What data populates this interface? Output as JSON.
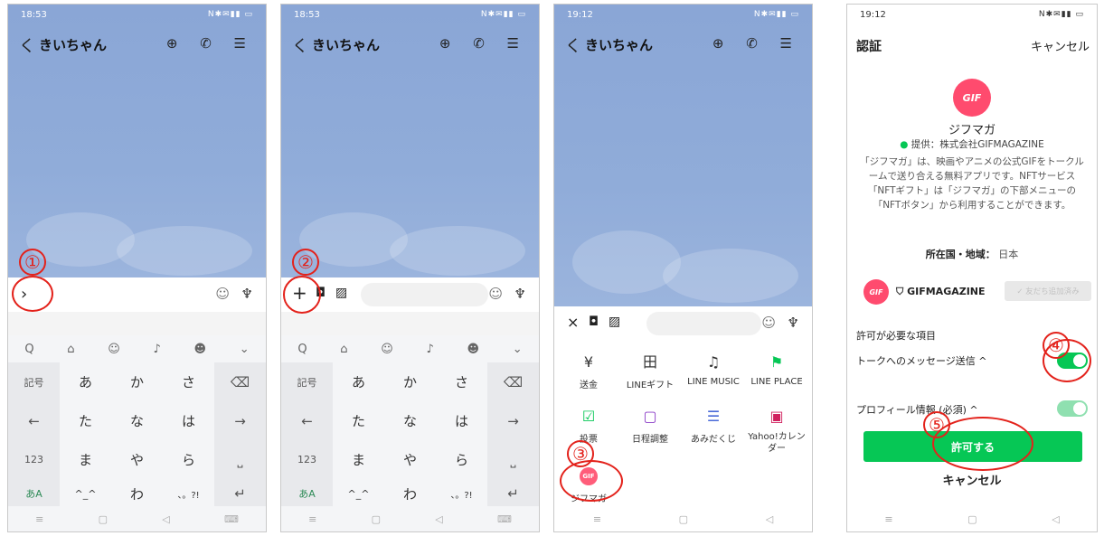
{
  "chat": {
    "status_time_1": "18:53",
    "status_time_3": "19:12",
    "status_icons": "N✱✉▮▮ ▭",
    "contact_name": "きいちゃん",
    "back": "く",
    "header_icons": "⊕ ✆ ☰"
  },
  "keyboard": {
    "top_icons": [
      "Q",
      "⌂",
      "☺",
      "♪",
      "☻",
      "⌄"
    ],
    "rows": [
      [
        "記号",
        "あ",
        "か",
        "さ",
        "⌫"
      ],
      [
        "←",
        "た",
        "な",
        "は",
        "→"
      ],
      [
        "123",
        "ま",
        "や",
        "ら",
        "⎵"
      ],
      [
        "あA",
        "^_^",
        "わ",
        "、。?!",
        "↵"
      ]
    ]
  },
  "annotations": [
    "①",
    "②",
    "③",
    "④",
    "⑤"
  ],
  "menu": {
    "items": [
      {
        "label": "送金",
        "icon": "¥"
      },
      {
        "label": "LINEギフト",
        "icon": "田"
      },
      {
        "label": "LINE MUSIC",
        "icon": "♫"
      },
      {
        "label": "LINE PLACE",
        "icon": "⚑"
      },
      {
        "label": "投票",
        "icon": "☑"
      },
      {
        "label": "日程調整",
        "icon": "▢"
      },
      {
        "label": "あみだくじ",
        "icon": "☰"
      },
      {
        "label": "Yahoo!カレンダー",
        "icon": "▣"
      },
      {
        "label": "ジフマガ",
        "icon": "GIF"
      }
    ]
  },
  "auth": {
    "status_time": "19:12",
    "title": "認証",
    "cancel_top": "キャンセル",
    "app_name": "ジフマガ",
    "provider": "提供：株式会社GIFMAGAZINE",
    "description": "「ジフマガ」は、映画やアニメの公式GIFをトークルームで送り合える無料アプリです。NFTサービス「NFTギフト」は「ジフマガ」の下部メニューの「NFTボタン」から利用することができます。",
    "region_label": "所在国・地域：",
    "region_value": "日本",
    "account_name": "GIFMAGAZINE",
    "friend_button": "✓ 友だち追加済み",
    "permissions_header": "許可が必要な項目",
    "permission_1": "トークへのメッセージ送信 ^",
    "permission_2": "プロフィール情報 (必須) ^",
    "allow_button": "許可する",
    "cancel_bottom": "キャンセル",
    "gif_icon": "GIF"
  },
  "nav": [
    "≡",
    "▢",
    "◁",
    "⌨"
  ],
  "colors": {
    "line_green": "#06c755",
    "annotation_red": "#e3221b",
    "chat_bg": "#8aa6d6"
  }
}
